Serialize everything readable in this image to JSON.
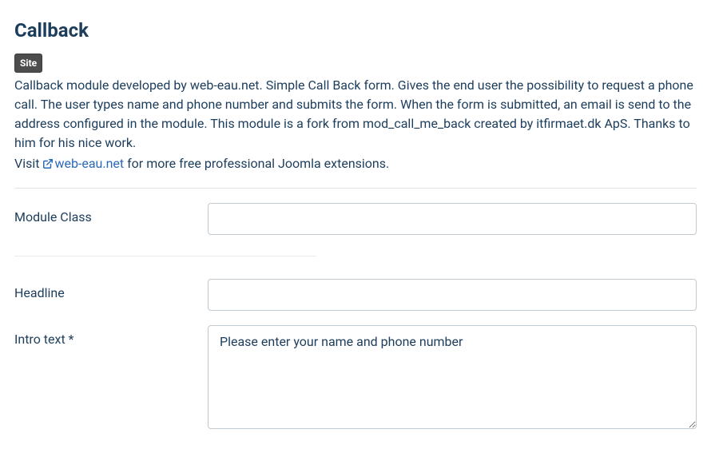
{
  "header": {
    "title": "Callback",
    "badge": "Site",
    "description": "Callback module developed by web-eau.net. Simple Call Back form. Gives the end user the possibility to request a phone call. The user types name and phone number and submits the form. When the form is submitted, an email is send to the address configured in the module. This module is a fork from mod_call_me_back created by itfirmaet.dk ApS. Thanks to him for his nice work.",
    "visit_prefix": "Visit ",
    "link_text": "web-eau.net",
    "visit_suffix": " for more free professional Joomla extensions."
  },
  "form": {
    "module_class": {
      "label": "Module Class",
      "value": ""
    },
    "headline": {
      "label": "Headline",
      "value": ""
    },
    "intro_text": {
      "label": "Intro text *",
      "value": "Please enter your name and phone number"
    }
  }
}
